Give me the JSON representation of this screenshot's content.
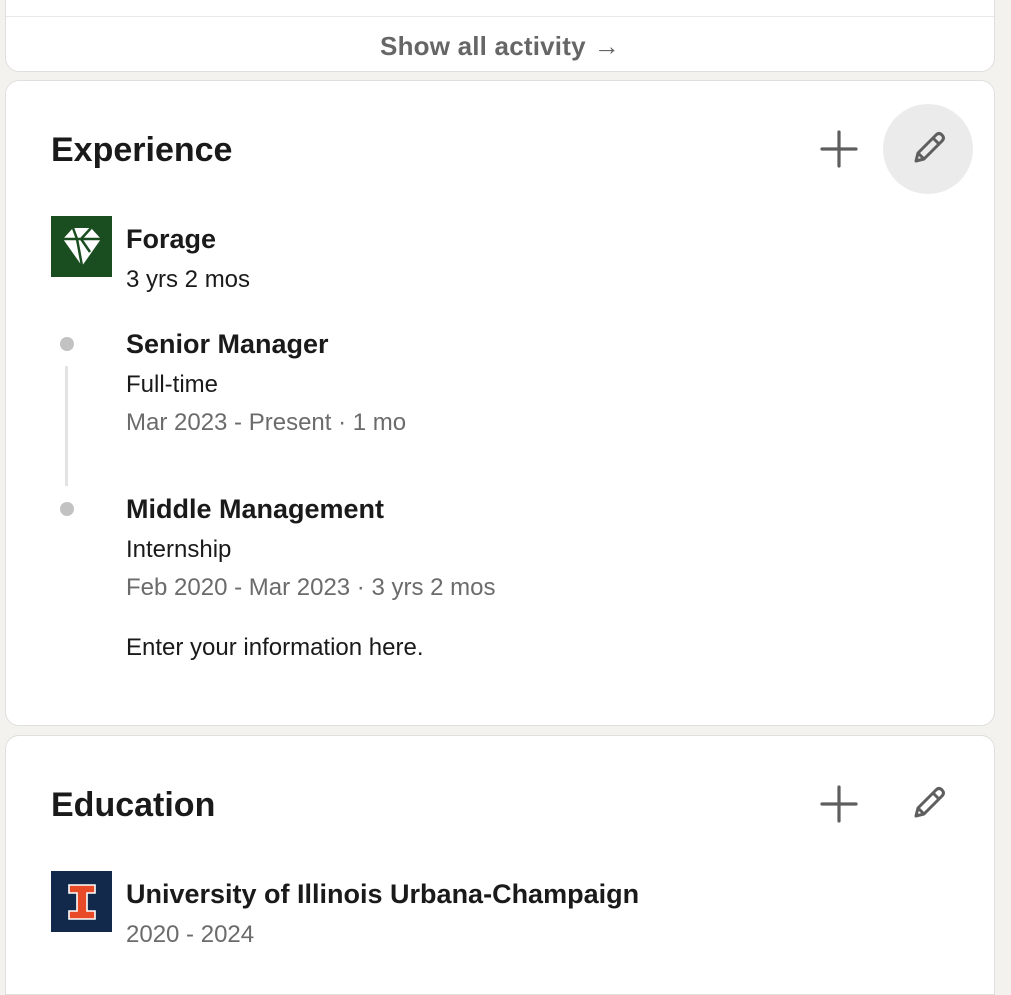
{
  "activity": {
    "show_all_label": "Show all activity",
    "arrow": "→"
  },
  "experience": {
    "title": "Experience",
    "add_icon": "plus-icon",
    "edit_icon": "pencil-icon",
    "company": {
      "name": "Forage",
      "duration": "3 yrs 2 mos",
      "logo_color": "#1a4d1f"
    },
    "positions": [
      {
        "title": "Senior Manager",
        "type": "Full-time",
        "dates": "Mar 2023 - Present · 1 mo"
      },
      {
        "title": "Middle Management",
        "type": "Internship",
        "dates": "Feb 2020 - Mar 2023 · 3 yrs 2 mos",
        "description": "Enter your information here."
      }
    ]
  },
  "education": {
    "title": "Education",
    "add_icon": "plus-icon",
    "edit_icon": "pencil-icon",
    "schools": [
      {
        "name": "University of Illinois Urbana-Champaign",
        "dates": "2020 - 2024",
        "logo_color": "#13294b",
        "logo_accent": "#e84a27"
      }
    ]
  }
}
